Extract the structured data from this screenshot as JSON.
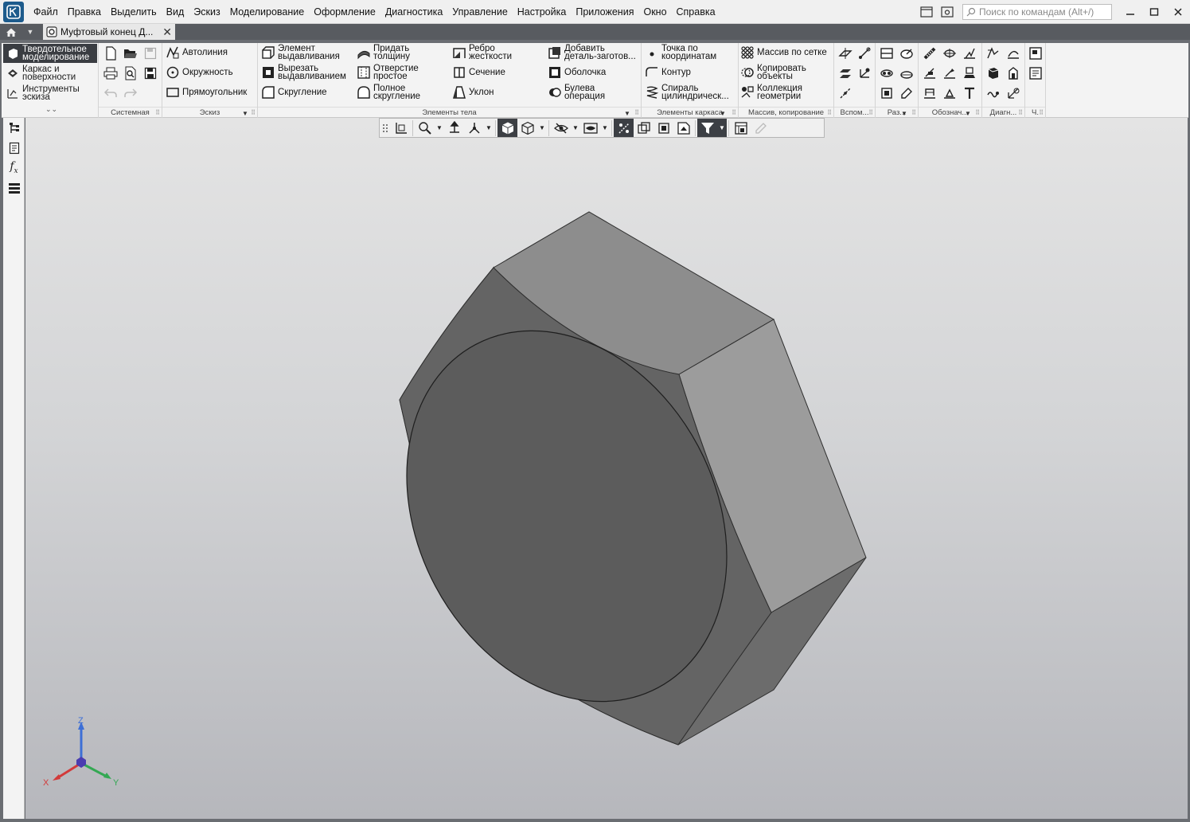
{
  "menubar": {
    "items": [
      "Файл",
      "Правка",
      "Выделить",
      "Вид",
      "Эскиз",
      "Моделирование",
      "Оформление",
      "Диагностика",
      "Управление",
      "Настройка",
      "Приложения",
      "Окно",
      "Справка"
    ],
    "search_placeholder": "Поиск по командам (Alt+/)"
  },
  "tabs": {
    "document_title": "Муфтовый конец Д..."
  },
  "ribbon": {
    "modes": [
      "Твердотельное\nмоделирование",
      "Каркас и\nповерхности",
      "Инструменты\nэскиза"
    ],
    "groups": {
      "system": "Системная",
      "sketch": "Эскиз",
      "body": "Элементы тела",
      "wire": "Элементы каркаса",
      "array": "Массив, копирование",
      "aux": "Вспом...",
      "dim": "Раз...",
      "notation": "Обознач...",
      "diag": "Диагн...",
      "ch": "Ч."
    },
    "sketch_buttons": [
      "Автолиния",
      "Окружность",
      "Прямоугольник"
    ],
    "body_buttons": {
      "extrude": "Элемент\nвыдавливания",
      "cut_extrude": "Вырезать\nвыдавливанием",
      "fillet": "Скругление",
      "thicken": "Придать\nтолщину",
      "hole": "Отверстие\nпростое",
      "full_round": "Полное\nскругление",
      "rib": "Ребро\nжесткости",
      "section": "Сечение",
      "draft": "Уклон",
      "add_blank": "Добавить\nдеталь-заготов...",
      "shell": "Оболочка",
      "boolean": "Булева\nоперация"
    },
    "wire_buttons": {
      "point": "Точка по\nкоординатам",
      "contour": "Контур",
      "helix": "Спираль\nцилиндрическ..."
    },
    "array_buttons": {
      "grid_array": "Массив по сетке",
      "copy_objects": "Копировать\nобъекты",
      "geometry_collection": "Коллекция\nгеометрии"
    }
  },
  "triad": {
    "x": "X",
    "y": "Y",
    "z": "Z"
  },
  "colors": {
    "accent_dark": "#3a3d42",
    "model_face_front": "#5f5f5f",
    "model_face_top": "#8c8c8c",
    "model_face_right": "#9b9b9b",
    "axis_x": "#d23a3a",
    "axis_y": "#34a853",
    "axis_z": "#3d6fd6"
  }
}
